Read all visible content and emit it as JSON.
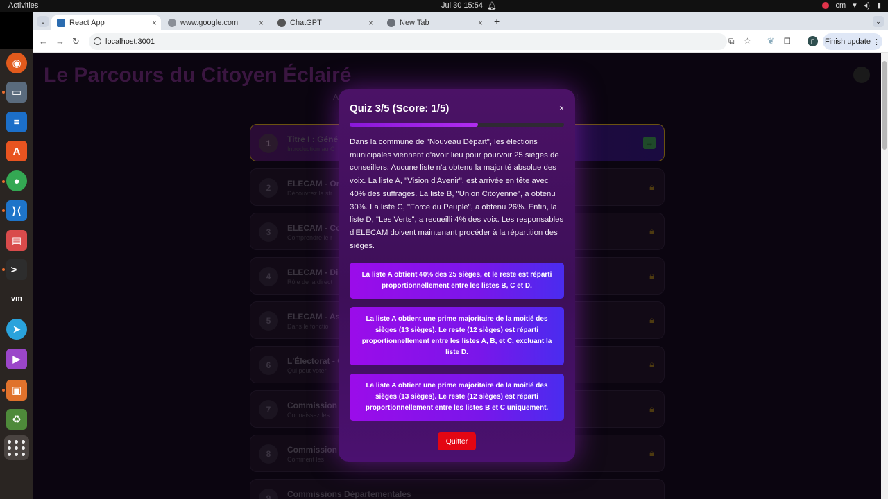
{
  "system": {
    "activities": "Activities",
    "clock": "Jul 30  15:54",
    "keyboard": "cm"
  },
  "browser": {
    "tabs": [
      {
        "label": "React App",
        "active": true
      },
      {
        "label": "www.google.com",
        "active": false
      },
      {
        "label": "ChatGPT",
        "active": false
      },
      {
        "label": "New Tab",
        "active": false
      }
    ],
    "url": "localhost:3001",
    "avatar_letter": "F",
    "finish_update": "Finish update"
  },
  "page": {
    "title": "Le Parcours du Citoyen Éclairé",
    "subtitle_left": "A",
    "subtitle_right": "!",
    "chapters": [
      {
        "num": "1",
        "title": "Titre I : Géné",
        "desc": "Introduction au C",
        "state": "unlocked"
      },
      {
        "num": "2",
        "title": "ELECAM - Or",
        "desc": "Découvrez la str",
        "state": "locked"
      },
      {
        "num": "3",
        "title": "ELECAM - Co",
        "desc": "Comprendre le r",
        "state": "locked"
      },
      {
        "num": "4",
        "title": "ELECAM - Di",
        "desc": "Rôle de la direct",
        "state": "locked"
      },
      {
        "num": "5",
        "title": "ELECAM - Ass",
        "desc": "Dans le fonctio",
        "state": "locked"
      },
      {
        "num": "6",
        "title": "L'Électorat - C",
        "desc": "Qui peut voter",
        "state": "locked"
      },
      {
        "num": "7",
        "title": "Commission",
        "desc": "Connaissez les",
        "state": "locked"
      },
      {
        "num": "8",
        "title": "Commission",
        "desc": "Comment les",
        "state": "locked"
      },
      {
        "num": "9",
        "title": "Commissions Départementales",
        "desc": "",
        "state": "locked"
      }
    ]
  },
  "quiz": {
    "title": "Quiz 3/5 (Score: 1/5)",
    "close": "×",
    "progress": 0.6,
    "question": "Dans la commune de \"Nouveau Départ\", les élections municipales viennent d'avoir lieu pour pourvoir 25 sièges de conseillers. Aucune liste n'a obtenu la majorité absolue des voix. La liste A, \"Vision d'Avenir\", est arrivée en tête avec 40% des suffrages. La liste B, \"Union Citoyenne\", a obtenu 30%. La liste C, \"Force du Peuple\", a obtenu 26%. Enfin, la liste D, \"Les Verts\", a recueilli 4% des voix. Les responsables d'ELECAM doivent maintenant procéder à la répartition des sièges.",
    "answers": [
      "La liste A obtient 40% des 25 sièges, et le reste est réparti proportionnellement entre les listes B, C et D.",
      "La liste A obtient une prime majoritaire de la moitié des sièges (13 sièges). Le reste (12 sièges) est réparti proportionnellement entre les listes A, B, et C, excluant la liste D.",
      "La liste A obtient une prime majoritaire de la moitié des sièges (13 sièges). Le reste (12 sièges) est réparti proportionnellement entre les listes B et C uniquement."
    ],
    "quit": "Quitter"
  }
}
